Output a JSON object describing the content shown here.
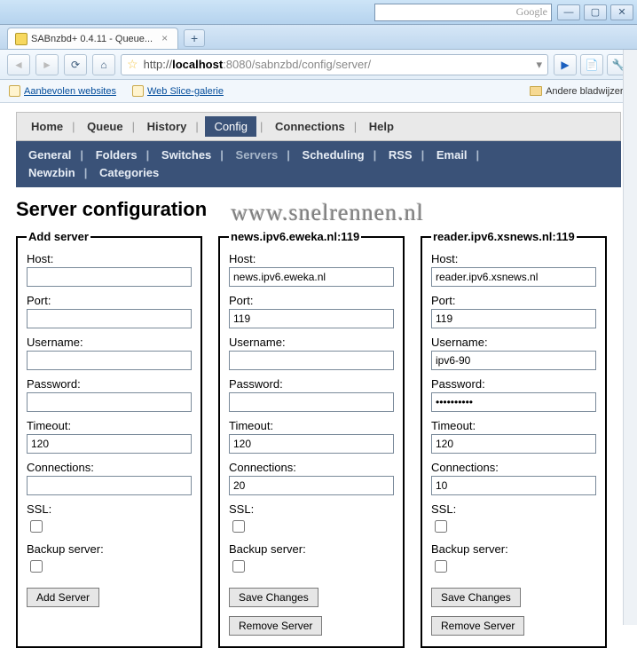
{
  "browser": {
    "tab_title": "SABnzbd+ 0.4.11 - Queue...",
    "search_label": "Google",
    "url_html": "http://<b>localhost</b>:8080/sabnzbd/config/server/",
    "bookmarks": {
      "aanbevolen": "Aanbevolen websites",
      "webslice": "Web Slice-galerie",
      "andere": "Andere bladwijzers"
    }
  },
  "topnav": {
    "items": [
      "Home",
      "Queue",
      "History",
      "Config",
      "Connections",
      "Help"
    ],
    "active": "Config"
  },
  "subnav": {
    "row1": [
      "General",
      "Folders",
      "Switches",
      "Servers",
      "Scheduling",
      "RSS",
      "Email"
    ],
    "row2": [
      "Newzbin",
      "Categories"
    ],
    "active": "Servers"
  },
  "page_title": "Server configuration",
  "watermark": "www.snelrennen.nl",
  "labels": {
    "host": "Host:",
    "port": "Port:",
    "username": "Username:",
    "password": "Password:",
    "timeout": "Timeout:",
    "connections": "Connections:",
    "ssl": "SSL:",
    "backup": "Backup server:",
    "add_server": "Add Server",
    "save_changes": "Save Changes",
    "remove_server": "Remove Server"
  },
  "servers": [
    {
      "legend": "Add server",
      "host": "",
      "port": "",
      "username": "",
      "password": "",
      "timeout": "120",
      "connections": "",
      "ssl": false,
      "backup": false,
      "is_new": true
    },
    {
      "legend": "news.ipv6.eweka.nl:119",
      "host": "news.ipv6.eweka.nl",
      "port": "119",
      "username": "",
      "password": "",
      "timeout": "120",
      "connections": "20",
      "ssl": false,
      "backup": false,
      "is_new": false
    },
    {
      "legend": "reader.ipv6.xsnews.nl:119",
      "host": "reader.ipv6.xsnews.nl",
      "port": "119",
      "username": "ipv6-90",
      "password": "••••••••••",
      "timeout": "120",
      "connections": "10",
      "ssl": false,
      "backup": false,
      "is_new": false
    }
  ]
}
